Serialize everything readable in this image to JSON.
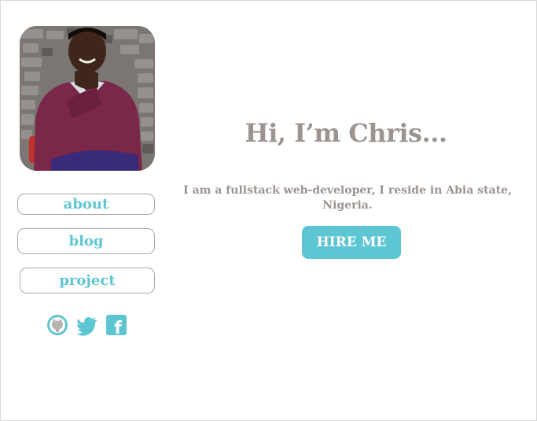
{
  "profile": {
    "photo_alt": "portrait photo"
  },
  "nav": {
    "about": "about",
    "blog": "blog",
    "project": "project"
  },
  "social": {
    "icons": [
      "github-icon",
      "twitter-icon",
      "facebook-icon"
    ],
    "facebook_letter": "f"
  },
  "hero": {
    "headline": "Hi, I’m Chris...",
    "bio": "I am a fullstack web-developer, I reside in Abia state, Nigeria.",
    "cta": "HIRE ME"
  },
  "colors": {
    "accent": "#5ec6d2",
    "text_muted": "#9b9491",
    "border": "#a9a9a9"
  }
}
